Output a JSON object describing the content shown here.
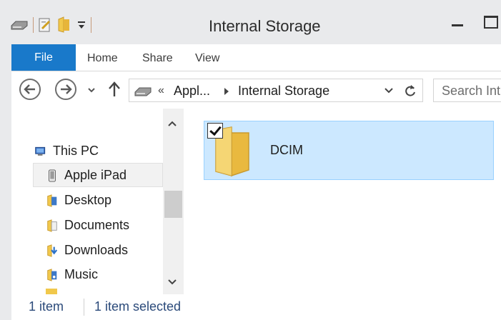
{
  "window": {
    "title": "Internal Storage",
    "quick_access_icons": [
      "drive-icon",
      "properties-icon",
      "new-folder-icon",
      "customize-qat-icon"
    ]
  },
  "ribbon": {
    "tabs": [
      {
        "label": "File"
      },
      {
        "label": "Home"
      },
      {
        "label": "Share"
      },
      {
        "label": "View"
      }
    ]
  },
  "address_bar": {
    "overflow": "«",
    "segments": [
      "Appl...",
      "Internal Storage"
    ]
  },
  "search": {
    "placeholder": "Search Int"
  },
  "nav_pane": {
    "items": [
      {
        "label": "This PC",
        "icon": "computer-icon"
      },
      {
        "label": "Apple iPad",
        "icon": "ipad-icon",
        "selected": true
      },
      {
        "label": "Desktop",
        "icon": "desktop-folder-icon"
      },
      {
        "label": "Documents",
        "icon": "documents-folder-icon"
      },
      {
        "label": "Downloads",
        "icon": "downloads-folder-icon"
      },
      {
        "label": "Music",
        "icon": "music-folder-icon"
      }
    ]
  },
  "content": {
    "items": [
      {
        "label": "DCIM",
        "icon": "folder-icon",
        "selected": true,
        "checked": true
      }
    ]
  },
  "status_bar": {
    "count": "1 item",
    "selection": "1 item selected"
  },
  "colors": {
    "accent": "#1979ca",
    "selection_fill": "#cce8ff",
    "selection_border": "#99d1ff"
  }
}
